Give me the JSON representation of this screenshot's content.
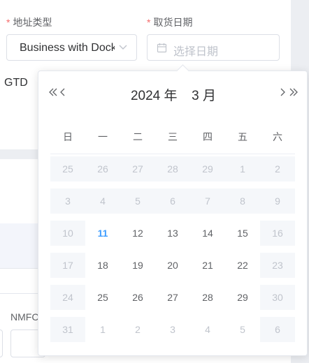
{
  "form": {
    "address_type": {
      "label": "地址类型",
      "required_mark": "*",
      "value": "Business with Dock"
    },
    "pickup_date": {
      "label": "取货日期",
      "required_mark": "*",
      "placeholder": "选择日期"
    },
    "gtd_label": "GTD",
    "nmfc_label": "NMFC"
  },
  "icons": {
    "chevron": "chevron-down-icon",
    "calendar": "calendar-icon"
  },
  "colors": {
    "accent": "#409eff",
    "required": "#f56c6c",
    "disabled_bg": "#f5f7fa",
    "muted_text": "#c0c4cc"
  },
  "picker": {
    "year": "2024",
    "year_suffix": "年",
    "month": "3",
    "month_suffix": "月",
    "weekdays": [
      "日",
      "一",
      "二",
      "三",
      "四",
      "五",
      "六"
    ],
    "weeks": [
      [
        {
          "day": "25",
          "state": "disabled"
        },
        {
          "day": "26",
          "state": "disabled"
        },
        {
          "day": "27",
          "state": "disabled"
        },
        {
          "day": "28",
          "state": "disabled"
        },
        {
          "day": "29",
          "state": "disabled"
        },
        {
          "day": "1",
          "state": "disabled"
        },
        {
          "day": "2",
          "state": "disabled"
        }
      ],
      [
        {
          "day": "3",
          "state": "disabled"
        },
        {
          "day": "4",
          "state": "disabled"
        },
        {
          "day": "5",
          "state": "disabled"
        },
        {
          "day": "6",
          "state": "disabled"
        },
        {
          "day": "7",
          "state": "disabled"
        },
        {
          "day": "8",
          "state": "disabled"
        },
        {
          "day": "9",
          "state": "disabled"
        }
      ],
      [
        {
          "day": "10",
          "state": "disabled"
        },
        {
          "day": "11",
          "state": "today"
        },
        {
          "day": "12",
          "state": "normal"
        },
        {
          "day": "13",
          "state": "normal"
        },
        {
          "day": "14",
          "state": "normal"
        },
        {
          "day": "15",
          "state": "normal"
        },
        {
          "day": "16",
          "state": "disabled"
        }
      ],
      [
        {
          "day": "17",
          "state": "disabled"
        },
        {
          "day": "18",
          "state": "normal"
        },
        {
          "day": "19",
          "state": "normal"
        },
        {
          "day": "20",
          "state": "normal"
        },
        {
          "day": "21",
          "state": "normal"
        },
        {
          "day": "22",
          "state": "normal"
        },
        {
          "day": "23",
          "state": "disabled"
        }
      ],
      [
        {
          "day": "24",
          "state": "disabled"
        },
        {
          "day": "25",
          "state": "normal"
        },
        {
          "day": "26",
          "state": "normal"
        },
        {
          "day": "27",
          "state": "normal"
        },
        {
          "day": "28",
          "state": "normal"
        },
        {
          "day": "29",
          "state": "normal"
        },
        {
          "day": "30",
          "state": "disabled"
        }
      ],
      [
        {
          "day": "31",
          "state": "disabled"
        },
        {
          "day": "1",
          "state": "other"
        },
        {
          "day": "2",
          "state": "other"
        },
        {
          "day": "3",
          "state": "other"
        },
        {
          "day": "4",
          "state": "other"
        },
        {
          "day": "5",
          "state": "other"
        },
        {
          "day": "6",
          "state": "disabled"
        }
      ]
    ]
  }
}
